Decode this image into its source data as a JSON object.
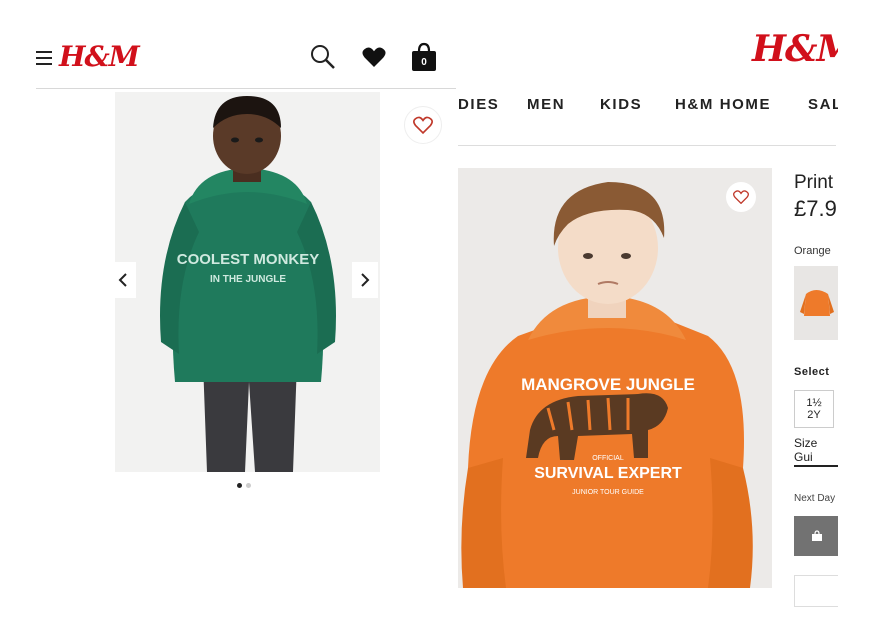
{
  "mobile": {
    "logo": "H&M",
    "bag_count": "0",
    "slides": {
      "active": 1,
      "total": 2
    },
    "product_print": {
      "line1": "COOLEST MONKEY",
      "line2": "IN THE JUNGLE"
    }
  },
  "desktop": {
    "logo": "H&M",
    "nav": [
      "DIES",
      "MEN",
      "KIDS",
      "H&M HOME",
      "SAL"
    ],
    "product_title": "Print",
    "price": "£7.9",
    "color_label": "Orange",
    "select_label": "Select",
    "size_option": "1½\n2Y",
    "size_guide": "Size Gui",
    "next_day": "Next Day",
    "product_print": {
      "line1": "MANGROVE JUNGLE",
      "line2": "OFFICIAL",
      "line3": "SURVIVAL EXPERT",
      "line4": "JUNIOR TOUR GUIDE"
    }
  },
  "colors": {
    "brand_red": "#d1101b",
    "green_hoodie": "#1f7a5c",
    "orange_hoodie": "#ee7a2a"
  }
}
